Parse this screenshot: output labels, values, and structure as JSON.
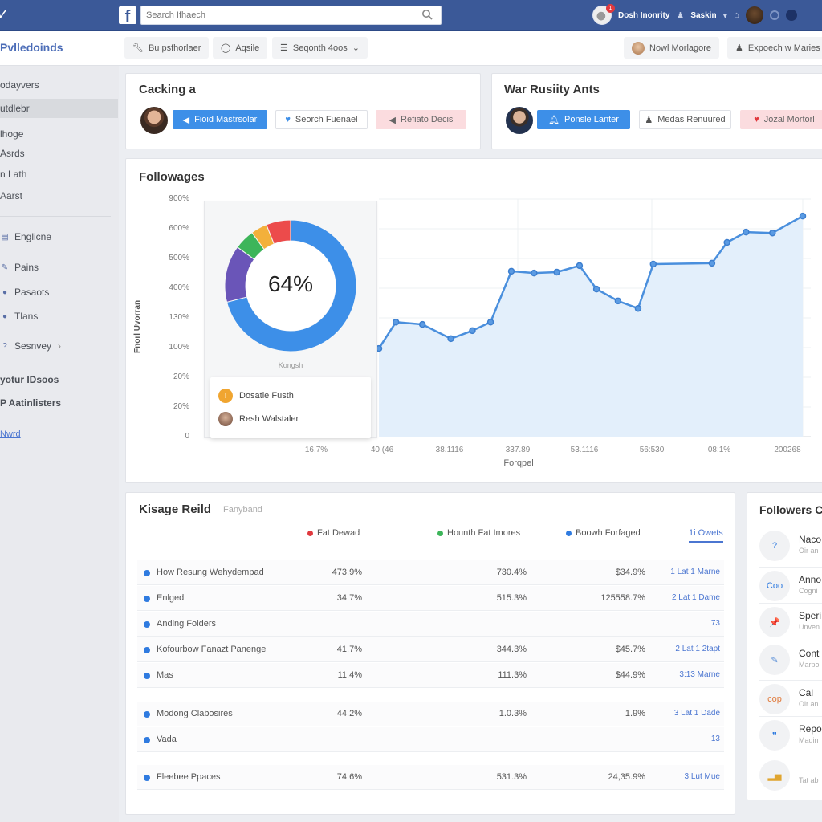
{
  "topbar": {
    "logo": "f",
    "search_placeholder": "Search Ifhaech",
    "user_name": "Dosh Inonrity",
    "notification_count": "1",
    "menu_label": "Saskin"
  },
  "subbar": {
    "brand": "Pvlledoinds",
    "buttons": [
      {
        "icon": "wrench-icon",
        "label": "Bu psfhorlaer"
      },
      {
        "icon": "circle-icon",
        "label": "Aqsile"
      },
      {
        "icon": "list-icon",
        "label": "Seqonth 4oos"
      }
    ],
    "right_buttons": [
      {
        "icon": "avatar",
        "label": "Nowl Morlagore"
      },
      {
        "icon": "user-icon",
        "label": "Expoech w Maries"
      }
    ]
  },
  "sidebar": {
    "top_items": [
      {
        "label": "odayvers",
        "active": false
      },
      {
        "label": "utdlebr",
        "active": true
      },
      {
        "label": "lhoge",
        "active": false
      },
      {
        "label": "Asrds",
        "active": false
      },
      {
        "label": "n Lath",
        "active": false
      },
      {
        "label": "Aarst",
        "active": false
      }
    ],
    "icon_items": [
      {
        "icon": "calendar-icon",
        "label": "Englicne"
      },
      {
        "icon": "pen-icon",
        "label": "Pains"
      },
      {
        "icon": "globe-icon",
        "label": "Pasaots"
      },
      {
        "icon": "tag-icon",
        "label": "Tlans"
      },
      {
        "icon": "help-icon",
        "label": "Sesnvey",
        "chevron": true
      }
    ],
    "bottom_items": [
      {
        "label": "yotur IDsoos"
      },
      {
        "label": "P Aatinlisters"
      }
    ],
    "link": "Nwrd"
  },
  "cards": [
    {
      "title": "Cacking a",
      "buttons": [
        {
          "style": "primary",
          "icon": "megaphone-icon",
          "label": "Fioid Mastrsolar"
        },
        {
          "style": "outline",
          "icon": "heart-icon",
          "label": "Seorch Fuenael"
        },
        {
          "style": "danger",
          "icon": "megaphone-icon",
          "label": "Refiato Decis"
        }
      ]
    },
    {
      "title": "War Rusiity Ants",
      "buttons": [
        {
          "style": "primary",
          "icon": "bell-icon",
          "label": "Ponsle Lanter"
        },
        {
          "style": "outline",
          "icon": "user-icon",
          "label": "Medas Renuured"
        },
        {
          "style": "danger",
          "icon": "heart-icon",
          "label": "Jozal Mortorl"
        }
      ]
    }
  ],
  "chart_data": [
    {
      "type": "area",
      "title": "Followages",
      "xlabel": "Forqpel",
      "ylabel": "Fnorl Uvorran",
      "y_tick_labels": [
        "0",
        "20%",
        "20%",
        "100%",
        "130%",
        "400%",
        "500%",
        "600%",
        "900%"
      ],
      "x_tick_labels": [
        "16.7%",
        "40 (46",
        "38.1116",
        "337.89",
        "53.1116",
        "56:530",
        "08:1%",
        "200268"
      ],
      "y_scale_note": "values expressed in gridline index units (0 = '0' tick, 8 = '900%' tick)",
      "ylim": [
        0,
        8
      ],
      "grid": true,
      "series": [
        {
          "name": "Followages",
          "color": "#4a8fdd",
          "values": [
            2.97,
            3.86,
            3.78,
            3.3,
            3.57,
            3.86,
            5.57,
            5.51,
            5.54,
            5.76,
            4.97,
            4.57,
            4.32,
            5.81,
            5.84,
            6.54,
            6.89,
            6.86,
            7.43
          ],
          "x_positions": [
            0.05,
            0.095,
            0.165,
            0.24,
            0.297,
            0.345,
            0.4,
            0.46,
            0.52,
            0.58,
            0.625,
            0.682,
            0.735,
            0.775,
            0.93,
            0.97,
            1.02,
            1.09,
            1.17
          ]
        }
      ]
    },
    {
      "type": "pie",
      "variant": "donut",
      "center_label": "64%",
      "caption": "Kongsh",
      "slices": [
        {
          "label": "Blue",
          "value": 71,
          "color": "#3d8fe8"
        },
        {
          "label": "Purple",
          "value": 14,
          "color": "#6a55b8"
        },
        {
          "label": "Green",
          "value": 5,
          "color": "#3db55a"
        },
        {
          "label": "Orange",
          "value": 4,
          "color": "#f3b03b"
        },
        {
          "label": "Red",
          "value": 6,
          "color": "#ec4b4b"
        }
      ],
      "legend": [
        {
          "icon": "badge-icon",
          "color": "#f0a530",
          "label": "Dosatle Fusth"
        },
        {
          "icon": "avatar",
          "color": "#a0705a",
          "label": "Resh Walstaler"
        }
      ]
    }
  ],
  "table": {
    "title": "Kisage Reild",
    "subtitle": "Fanyband",
    "columns": [
      {
        "label": "Fat Dewad",
        "color": "#e0393e"
      },
      {
        "label": "Hounth Fat Imores",
        "color": "#3db55a"
      },
      {
        "label": "Boowh Forfaged",
        "color": "#2f7be0"
      }
    ],
    "tab": "1i Owets",
    "rows": [
      {
        "name": "How Resung Wehydempad",
        "c1": "473.9%",
        "c2": "730.4%",
        "c3": "$34.9%",
        "c4": "1 Lat 1 Marne"
      },
      {
        "name": "Enlged",
        "c1": "34.7%",
        "c2": "515.3%",
        "c3": "125558.7%",
        "c4": "2 Lat 1 Dame"
      },
      {
        "name": "Anding Folders",
        "c1": "",
        "c2": "",
        "c3": "",
        "c4": "73"
      },
      {
        "name": "Kofourbow Fanazt Panenge",
        "c1": "41.7%",
        "c2": "344.3%",
        "c3": "$45.7%",
        "c4": "2 Lat 1 2tapt"
      },
      {
        "name": "Mas",
        "c1": "11.4%",
        "c2": "111.3%",
        "c3": "$44.9%",
        "c4": "3:13 Marne"
      },
      {
        "name": "Modong Clabosires",
        "c1": "44.2%",
        "c2": "1.0.3%",
        "c3": "1.9%",
        "c4": "3 Lat 1 Dade"
      },
      {
        "name": "Vada",
        "c1": "",
        "c2": "",
        "c3": "",
        "c4": "13"
      },
      {
        "name": "Fleebee Ppaces",
        "c1": "74.6%",
        "c2": "531.3%",
        "c3": "24,35.9%",
        "c4": "3 Lut Mue"
      }
    ]
  },
  "followers": {
    "title": "Followers C",
    "items": [
      {
        "icon": "help-circle-icon",
        "glyph": "?",
        "name": "Naco",
        "desc": "Oir an"
      },
      {
        "icon": "logo-icon",
        "glyph": "Coo",
        "name": "Anno",
        "desc": "Cogni"
      },
      {
        "icon": "pin-icon",
        "glyph": "📌",
        "name": "Speri",
        "desc": "Unven"
      },
      {
        "icon": "tools-icon",
        "glyph": "✎",
        "name": "Cont",
        "desc": "Marpo"
      },
      {
        "icon": "brand-icon",
        "glyph": "cop",
        "name": "Cal",
        "desc": "Oir an"
      },
      {
        "icon": "quote-icon",
        "glyph": "❞",
        "name": "Repo",
        "desc": "Madin"
      },
      {
        "icon": "chart-icon",
        "glyph": "▂▅",
        "name": "",
        "desc": "Tat ab"
      }
    ]
  }
}
